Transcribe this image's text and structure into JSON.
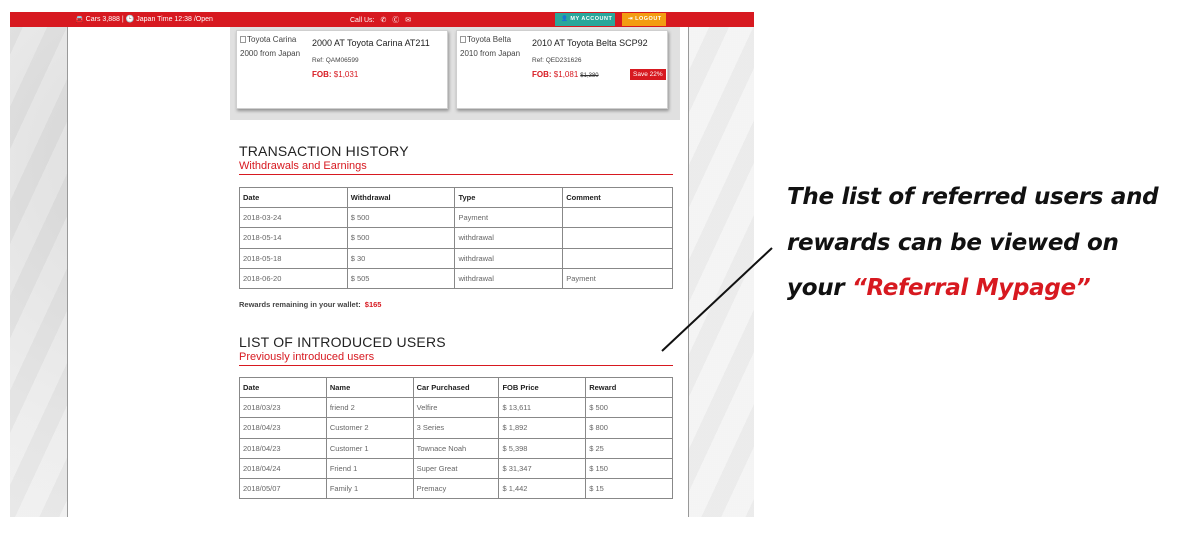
{
  "topbar": {
    "info": "🚘 Cars 3,888 | 🕒 Japan Time 12:38 /Open",
    "call_label": "Call Us:",
    "icons": [
      "phone-icon",
      "skype-icon",
      "mail-icon"
    ],
    "account_button": "👤 MY ACCOUNT",
    "logout_button": "⇥ LOGOUT",
    "colors": {
      "bar": "#d71920",
      "account": "#2aa79b",
      "logout": "#f39c12"
    }
  },
  "cards": [
    {
      "image_alt": "Toyota Carina",
      "sub": "2000 from Japan",
      "title": "2000 AT Toyota Carina AT211",
      "ref": "Ref: QAM06599",
      "fob_label": "FOB:",
      "fob_price": "$1,031",
      "old_price": "",
      "badge": ""
    },
    {
      "image_alt": "Toyota Belta",
      "sub": "2010 from Japan",
      "title": "2010 AT Toyota Belta SCP92",
      "ref": "Ref: QED231626",
      "fob_label": "FOB:",
      "fob_price": "$1,081",
      "old_price": "$1,380",
      "badge": "Save 22%"
    }
  ],
  "transactions": {
    "title": "TRANSACTION HISTORY",
    "subtitle": "Withdrawals and Earnings",
    "headers": [
      "Date",
      "Withdrawal",
      "Type",
      "Comment"
    ],
    "rows": [
      [
        "2018-03-24",
        "$ 500",
        "Payment",
        ""
      ],
      [
        "2018-05-14",
        "$ 500",
        "withdrawal",
        ""
      ],
      [
        "2018-05-18",
        "$ 30",
        "withdrawal",
        ""
      ],
      [
        "2018-06-20",
        "$ 505",
        "withdrawal",
        "Payment"
      ]
    ],
    "wallet_label": "Rewards remaining in your wallet:",
    "wallet_amount": "$165"
  },
  "referrals": {
    "title": "LIST OF INTRODUCED USERS",
    "subtitle": "Previously introduced users",
    "headers": [
      "Date",
      "Name",
      "Car Purchased",
      "FOB Price",
      "Reward"
    ],
    "rows": [
      [
        "2018/03/23",
        "friend 2",
        "Velfire",
        "$ 13,611",
        "$ 500"
      ],
      [
        "2018/04/23",
        "Customer 2",
        "3 Series",
        "$ 1,892",
        "$ 800"
      ],
      [
        "2018/04/23",
        "Customer 1",
        "Townace Noah",
        "$ 5,398",
        "$ 25"
      ],
      [
        "2018/04/24",
        "Friend 1",
        "Super Great",
        "$ 31,347",
        "$ 150"
      ],
      [
        "2018/05/07",
        "Family 1",
        "Premacy",
        "$ 1,442",
        "$ 15"
      ]
    ]
  },
  "callout": {
    "line1": "The list of referred users and",
    "line2": "rewards can be viewed on",
    "line3_prefix": "your ",
    "line3_highlight": "“Referral Mypage”",
    "highlight_color": "#d71920"
  }
}
